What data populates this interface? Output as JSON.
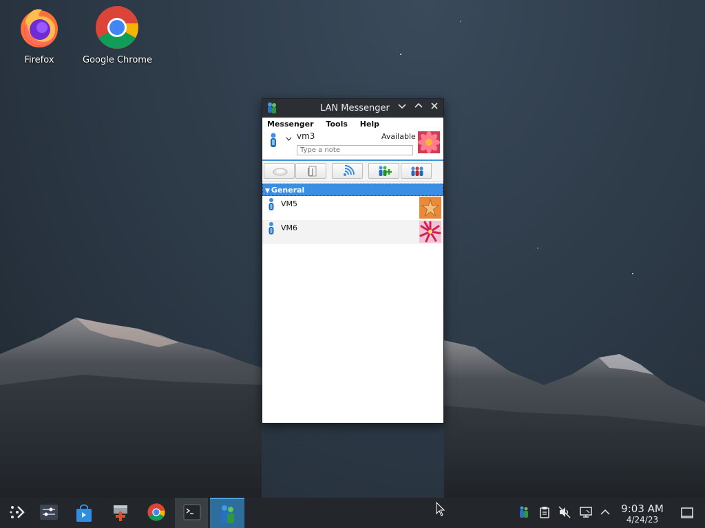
{
  "desktop": {
    "icons": [
      {
        "label": "Firefox",
        "icon": "firefox-icon"
      },
      {
        "label": "Google Chrome",
        "icon": "chrome-icon"
      }
    ]
  },
  "window": {
    "title": "LAN Messenger",
    "menu": [
      "Messenger",
      "Tools",
      "Help"
    ],
    "user": {
      "name": "vm3",
      "status": "Available",
      "note_placeholder": "Type a note"
    },
    "toolbar": [
      "chat-icon",
      "file-transfer-icon",
      "broadcast-icon",
      "add-contact-icon",
      "group-icon"
    ],
    "group": {
      "name": "General",
      "contacts": [
        {
          "name": "VM5",
          "avatar": "starfish"
        },
        {
          "name": "VM6",
          "avatar": "pink-flower"
        }
      ]
    }
  },
  "taskbar": {
    "apps": [
      "app-launcher-icon",
      "system-settings-icon",
      "discover-store-icon",
      "package-manager-icon",
      "chrome-icon",
      "terminal-icon",
      "lan-messenger-icon"
    ],
    "active_app": "lan-messenger-icon",
    "tray": [
      "lan-messenger-tray-icon",
      "clipboard-icon",
      "volume-muted-icon",
      "network-icon",
      "expand-tray-icon"
    ],
    "time": "9:03 AM",
    "date": "4/24/23"
  }
}
